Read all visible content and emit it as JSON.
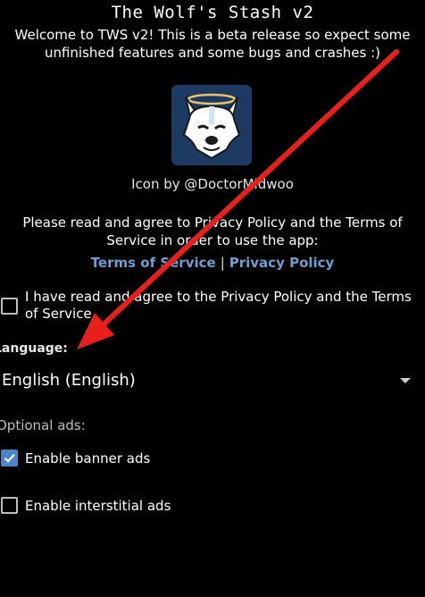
{
  "header": {
    "title": "The Wolf's Stash v2",
    "welcome": "Welcome to TWS v2! This is a beta release so expect some unfinished features and some bugs and crashes :)"
  },
  "icon": {
    "name": "wolf-logo-icon",
    "credit": "Icon by @DoctorMidwoo"
  },
  "legal": {
    "notice": "Please read and agree to Privacy Policy and the Terms of Service in order to use the app:",
    "terms_link": "Terms of Service",
    "separator": "|",
    "privacy_link": "Privacy Policy",
    "agree_label": "I have read and agree to the Privacy Policy and the Terms of Service",
    "agree_checked": false
  },
  "language": {
    "label": "Language:",
    "selected": "English (English)"
  },
  "ads": {
    "label": "Optional ads:",
    "options": [
      {
        "label": "Enable banner ads",
        "checked": true
      },
      {
        "label": "Enable interstitial ads",
        "checked": false
      }
    ]
  },
  "colors": {
    "background": "#000000",
    "link": "#6e9fd0",
    "checkbox_checked": "#4a86c7",
    "annotation_arrow": "#e8201c",
    "icon_background": "#1d3a63"
  }
}
